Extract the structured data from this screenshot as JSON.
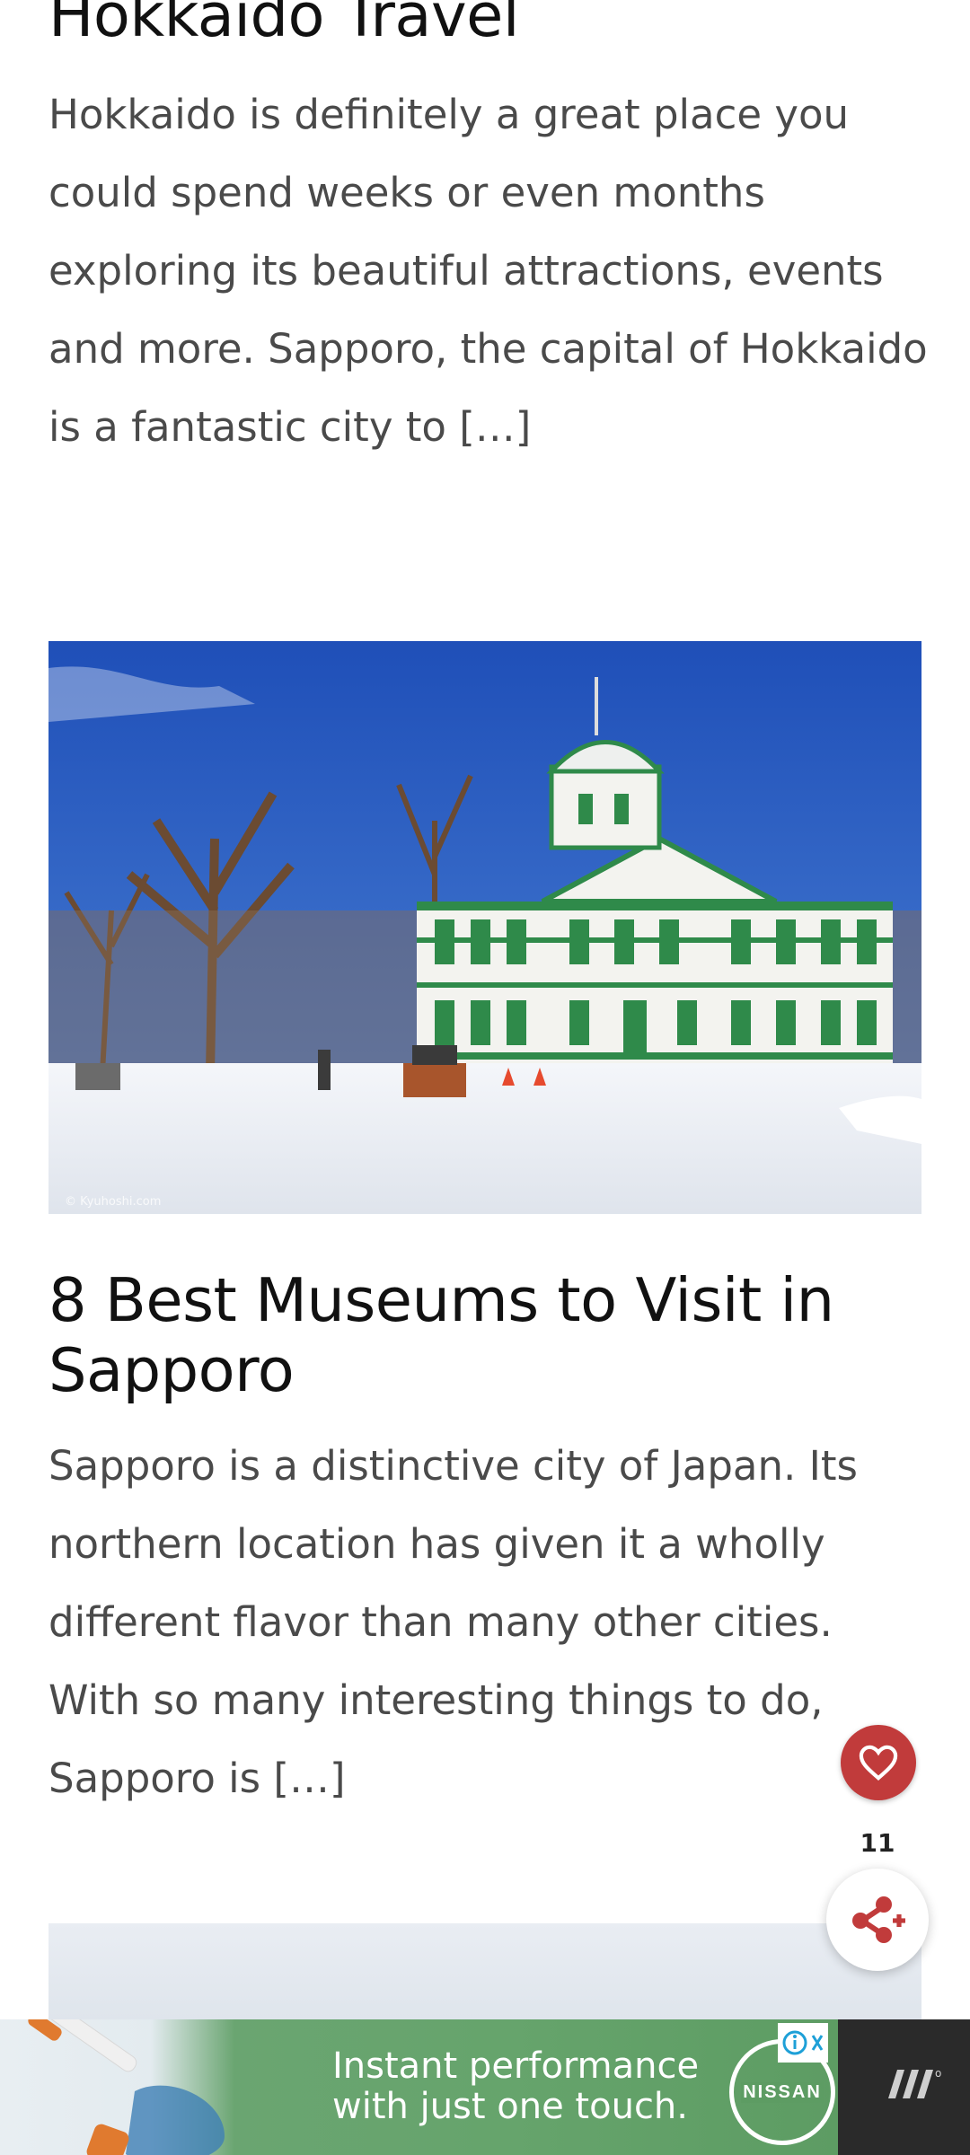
{
  "articles": [
    {
      "title": "Hokkaido Travel",
      "excerpt": "Hokkaido is definitely a great place you could spend weeks or even months exploring its beautiful attractions, events and more. Sapporo, the capital of Hokkaido is a fantastic city to […]"
    },
    {
      "title": "8 Best Museums to Visit in Sapporo",
      "excerpt": "Sapporo is a distinctive city of Japan. Its northern location has given it a wholly different flavor than many other cities. With so many interesting things to do, Sapporo is […]",
      "image": {
        "watermark": "© Kyuhoshi.com"
      }
    }
  ],
  "floating": {
    "like_icon": "heart-icon",
    "share_count": "11",
    "share_icon": "share-plus-icon"
  },
  "ad": {
    "line1": "Instant performance",
    "line2": "with just one touch.",
    "brand": "NISSAN"
  },
  "colors": {
    "like": "#c13b3b",
    "ad_green": "#66a46c"
  }
}
